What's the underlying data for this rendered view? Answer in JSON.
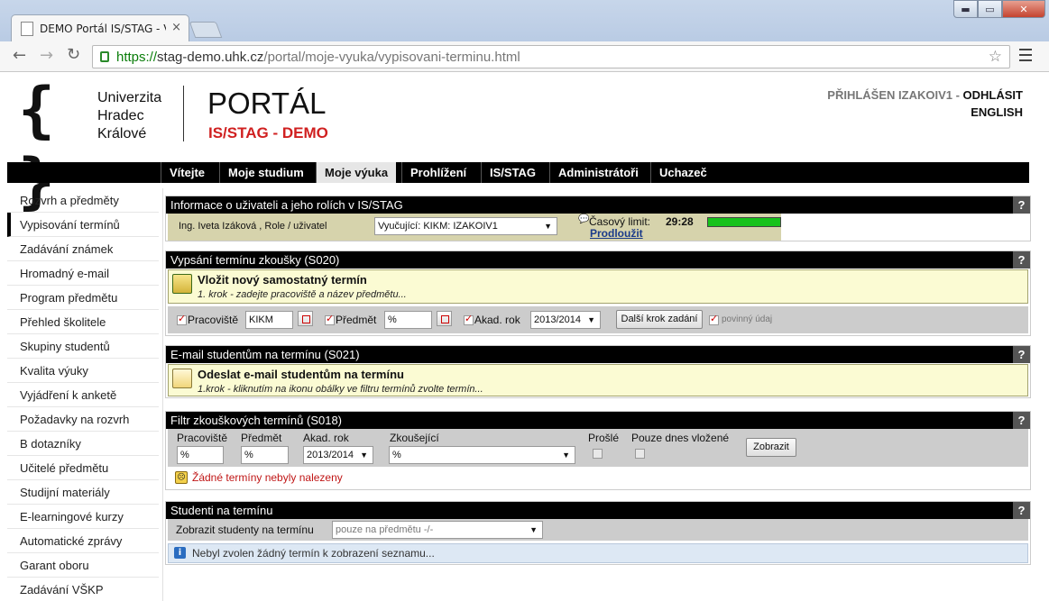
{
  "browser": {
    "tab_title": "DEMO Portál IS/STAG - Vy",
    "close_glyph": "×",
    "url_scheme": "https://",
    "url_host": "stag-demo.uhk.cz",
    "url_path": "/portal/moje-vyuka/vypisovani-terminu.html",
    "back_glyph": "←",
    "forward_glyph": "→",
    "reload_glyph": "↻",
    "star_glyph": "☆",
    "min_glyph": "▬",
    "max_glyph": "▭",
    "close_win_glyph": "✕"
  },
  "header": {
    "logo_brace": "{ }",
    "uni_line1": "Univerzita",
    "uni_line2": "Hradec",
    "uni_line3": "Králové",
    "portal_title": "PORTÁL",
    "portal_subtitle": "IS/STAG - DEMO",
    "logged_user": "PŘIHLÁŠEN IZAKOIV1",
    "separator": " - ",
    "logout": "ODHLÁSIT",
    "language": "ENGLISH"
  },
  "topnav": [
    "Vítejte",
    "Moje studium",
    "Moje výuka",
    "Prohlížení",
    "IS/STAG",
    "Administrátoři",
    "Uchazeč"
  ],
  "topnav_active": "Moje výuka",
  "sidebar": {
    "items": [
      "Rozvrh a předměty",
      "Vypisování termínů",
      "Zadávání známek",
      "Hromadný e-mail",
      "Program předmětu",
      "Přehled školitele",
      "Skupiny studentů",
      "Kvalita výuky",
      "Vyjádření k anketě",
      "Požadavky na rozvrh",
      "B dotazníky",
      "Učitelé předmětu",
      "Studijní materiály",
      "E-learningové kurzy",
      "Automatické zprávy",
      "Garant oboru",
      "Zadávání VŠKP"
    ],
    "active": "Vypisování termínů"
  },
  "help_glyph": "?",
  "user_panel": {
    "title": "Informace o uživateli a jeho rolích v IS/STAG",
    "user": "Ing. Iveta Izáková , Role / uživatel",
    "role_select": "Vyučující: KIKM: IZAKOIV1",
    "time_label": "Časový limit:",
    "time_value": "29:28",
    "time_fill": 1.0,
    "extend": "Prodloužit"
  },
  "s020": {
    "title": "Vypsání termínu zkoušky (S020)",
    "box_title": "Vložit nový samostatný termín",
    "box_sub": "1. krok - zadejte pracoviště a název předmětu...",
    "pracoviste_label": "Pracoviště",
    "pracoviste_value": "KIKM",
    "predmet_label": "Předmět",
    "predmet_value": "%",
    "rok_label": "Akad. rok",
    "rok_value": "2013/2014",
    "next_button": "Další krok zadání",
    "required": "povinný údaj"
  },
  "s021": {
    "title": "E-mail studentům na termínu (S021)",
    "box_title": "Odeslat e-mail studentům na termínu",
    "box_sub": "1.krok - kliknutím na ikonu obálky ve filtru termínů zvolte termín..."
  },
  "s018": {
    "title": "Filtr zkouškových termínů (S018)",
    "pracoviste_label": "Pracoviště",
    "pracoviste_value": "%",
    "predmet_label": "Předmět",
    "predmet_value": "%",
    "rok_label": "Akad. rok",
    "rok_value": "2013/2014",
    "zkousejici_label": "Zkoušející",
    "zkousejici_value": "%",
    "prosle_label": "Prošlé",
    "dnes_label": "Pouze dnes vložené",
    "show_button": "Zobrazit",
    "empty_msg": "Žádné termíny nebyly nalezeny"
  },
  "students": {
    "title": "Studenti na termínu",
    "show_label": "Zobrazit studenty na termínu",
    "show_select": "pouze na předmětu -/-",
    "info": "Nebyl zvolen žádný termín k zobrazení seznamu..."
  },
  "colors": {
    "accent_red": "#d02020",
    "nav_black": "#000000",
    "timer_green": "#17c21c",
    "info_blue": "#dde8f4"
  }
}
